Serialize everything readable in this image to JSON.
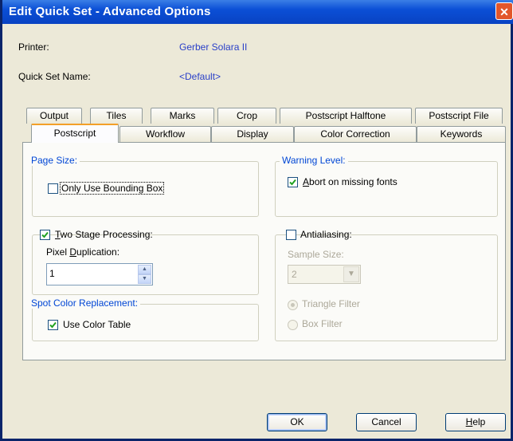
{
  "window": {
    "title": "Edit Quick Set - Advanced Options",
    "close_symbol": "✕"
  },
  "info": {
    "printer_label": "Printer:",
    "printer_value": "Gerber Solara II",
    "quickset_label": "Quick Set Name:",
    "quickset_value": "<Default>"
  },
  "tabs_back": [
    "Output",
    "Tiles",
    "Marks",
    "Crop",
    "Postscript Halftone",
    "Postscript File"
  ],
  "tabs_front": [
    "Postscript",
    "Workflow",
    "Display",
    "Color Correction",
    "Keywords"
  ],
  "active_tab": "Postscript",
  "page_size": {
    "legend": "Page Size:",
    "bounding_box_label": "Only Use Bounding Box",
    "bounding_box_checked": false
  },
  "warning_level": {
    "legend": "Warning Level:",
    "abort_label": "Abort on missing fonts",
    "abort_checked": true
  },
  "two_stage": {
    "label_first": "T",
    "label_rest": "wo Stage Processing:",
    "checked": true,
    "pixel_dup_pre": "Pixel ",
    "pixel_dup_u": "D",
    "pixel_dup_post": "uplication:",
    "pixel_dup_value": "1"
  },
  "antialiasing": {
    "label": "Antialiasing:",
    "checked": false,
    "sample_size_label": "Sample Size:",
    "sample_size_value": "2",
    "triangle_filter": "Triangle Filter",
    "box_filter": "Box Filter",
    "selected_filter": "Triangle Filter"
  },
  "spot_color": {
    "legend": "Spot Color Replacement:",
    "use_table_label": "Use Color Table",
    "use_table_checked": true
  },
  "buttons": {
    "ok": "OK",
    "cancel": "Cancel",
    "help_u": "H",
    "help_rest": "elp"
  },
  "colors": {
    "title_bar": "#0b4fd6",
    "link_blue": "#2a40c8",
    "active_tab_accent": "#f3a028",
    "window_bg": "#ece9d8"
  }
}
